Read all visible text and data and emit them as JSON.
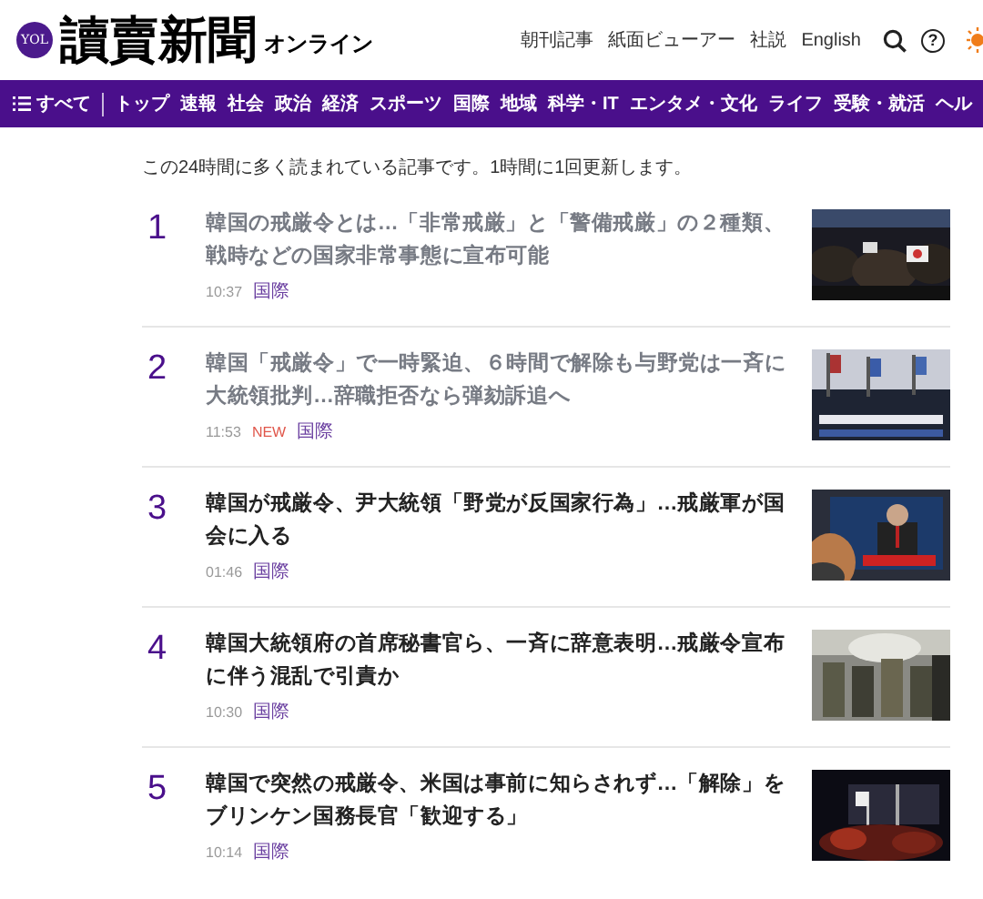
{
  "header": {
    "logo_badge": "YOL",
    "logo_title": "讀賣新聞",
    "logo_suffix": "オンライン",
    "links": [
      "朝刊記事",
      "紙面ビューアー",
      "社説",
      "English"
    ],
    "help_glyph": "?"
  },
  "nav": {
    "menu_label": "すべて",
    "items": [
      "トップ",
      "速報",
      "社会",
      "政治",
      "経済",
      "スポーツ",
      "国際",
      "地域",
      "科学・IT",
      "エンタメ・文化",
      "ライフ",
      "受験・就活",
      "ヘル"
    ]
  },
  "intro": "この24時間に多く読まれている記事です。1時間に1回更新します。",
  "articles": [
    {
      "rank": "1",
      "title": "韓国の戒厳令とは…「非常戒厳」と「警備戒厳」の２種類、戦時などの国家非常事態に宣布可能",
      "visited": true,
      "time": "10:37",
      "new": false,
      "category": "国際",
      "kind": "picture"
    },
    {
      "rank": "2",
      "title": "韓国「戒厳令」で一時緊迫、６時間で解除も与野党は一斉に大統領批判…辞職拒否なら弾劾訴追へ",
      "visited": true,
      "time": "11:53",
      "new": true,
      "new_label": "NEW",
      "category": "国際",
      "kind": "picture"
    },
    {
      "rank": "3",
      "title": "韓国が戒厳令、尹大統領「野党が反国家行為」…戒厳軍が国会に入る",
      "visited": false,
      "time": "01:46",
      "new": false,
      "category": "国際",
      "kind": "picture"
    },
    {
      "rank": "4",
      "title": "韓国大統領府の首席秘書官ら、一斉に辞意表明…戒厳令宣布に伴う混乱で引責か",
      "visited": false,
      "time": "10:30",
      "new": false,
      "category": "国際",
      "kind": "picture"
    },
    {
      "rank": "5",
      "title": "韓国で突然の戒厳令、米国は事前に知らされず…「解除」をブリンケン国務長官「歓迎する」",
      "visited": false,
      "time": "10:14",
      "new": false,
      "category": "国際",
      "kind": "picture"
    }
  ]
}
